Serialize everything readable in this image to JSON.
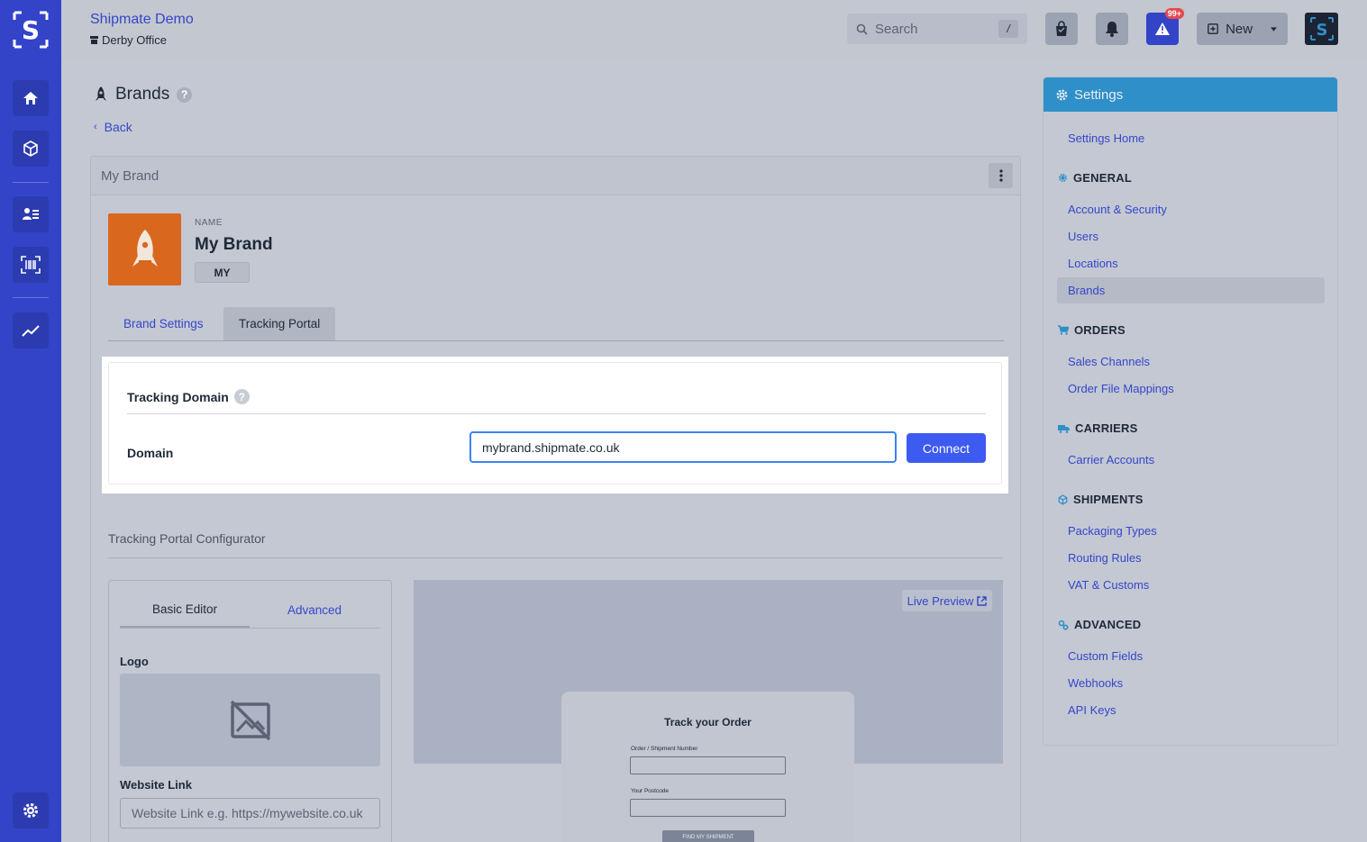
{
  "topbar": {
    "org_name": "Shipmate Demo",
    "org_location": "Derby Office",
    "search_placeholder": "Search",
    "search_shortcut": "/",
    "alerts_badge": "99+",
    "new_label": "New"
  },
  "page": {
    "title": "Brands",
    "back_label": "Back"
  },
  "brand": {
    "card_title": "My Brand",
    "name_label": "NAME",
    "name": "My Brand",
    "code": "MY",
    "logo_color": "#d9671e"
  },
  "tabs": [
    "Brand Settings",
    "Tracking Portal"
  ],
  "tracking_domain": {
    "title": "Tracking Domain",
    "domain_label": "Domain",
    "domain_value": "mybrand.shipmate.co.uk",
    "connect_label": "Connect"
  },
  "configurator": {
    "title": "Tracking Portal Configurator",
    "tabs": [
      "Basic Editor",
      "Advanced"
    ],
    "logo_label": "Logo",
    "website_label": "Website Link",
    "website_placeholder": "Website Link e.g. https://mywebsite.co.uk",
    "live_preview_label": "Live Preview",
    "preview": {
      "title": "Track your Order",
      "field1_label": "Order / Shipment Number",
      "field2_label": "Your Postcode",
      "button_label": "FIND MY SHIPMENT"
    }
  },
  "settings": {
    "title": "Settings",
    "home": "Settings Home",
    "sections": {
      "general": {
        "title": "GENERAL",
        "items": [
          "Account & Security",
          "Users",
          "Locations",
          "Brands"
        ]
      },
      "orders": {
        "title": "ORDERS",
        "items": [
          "Sales Channels",
          "Order File Mappings"
        ]
      },
      "carriers": {
        "title": "CARRIERS",
        "items": [
          "Carrier Accounts"
        ]
      },
      "shipments": {
        "title": "SHIPMENTS",
        "items": [
          "Packaging Types",
          "Routing Rules",
          "VAT & Customs"
        ]
      },
      "advanced": {
        "title": "ADVANCED",
        "items": [
          "Custom Fields",
          "Webhooks",
          "API Keys"
        ]
      }
    }
  },
  "colors": {
    "rail": "#3344c9",
    "accent": "#3d5af1",
    "settings_header": "#2f8fc8"
  }
}
